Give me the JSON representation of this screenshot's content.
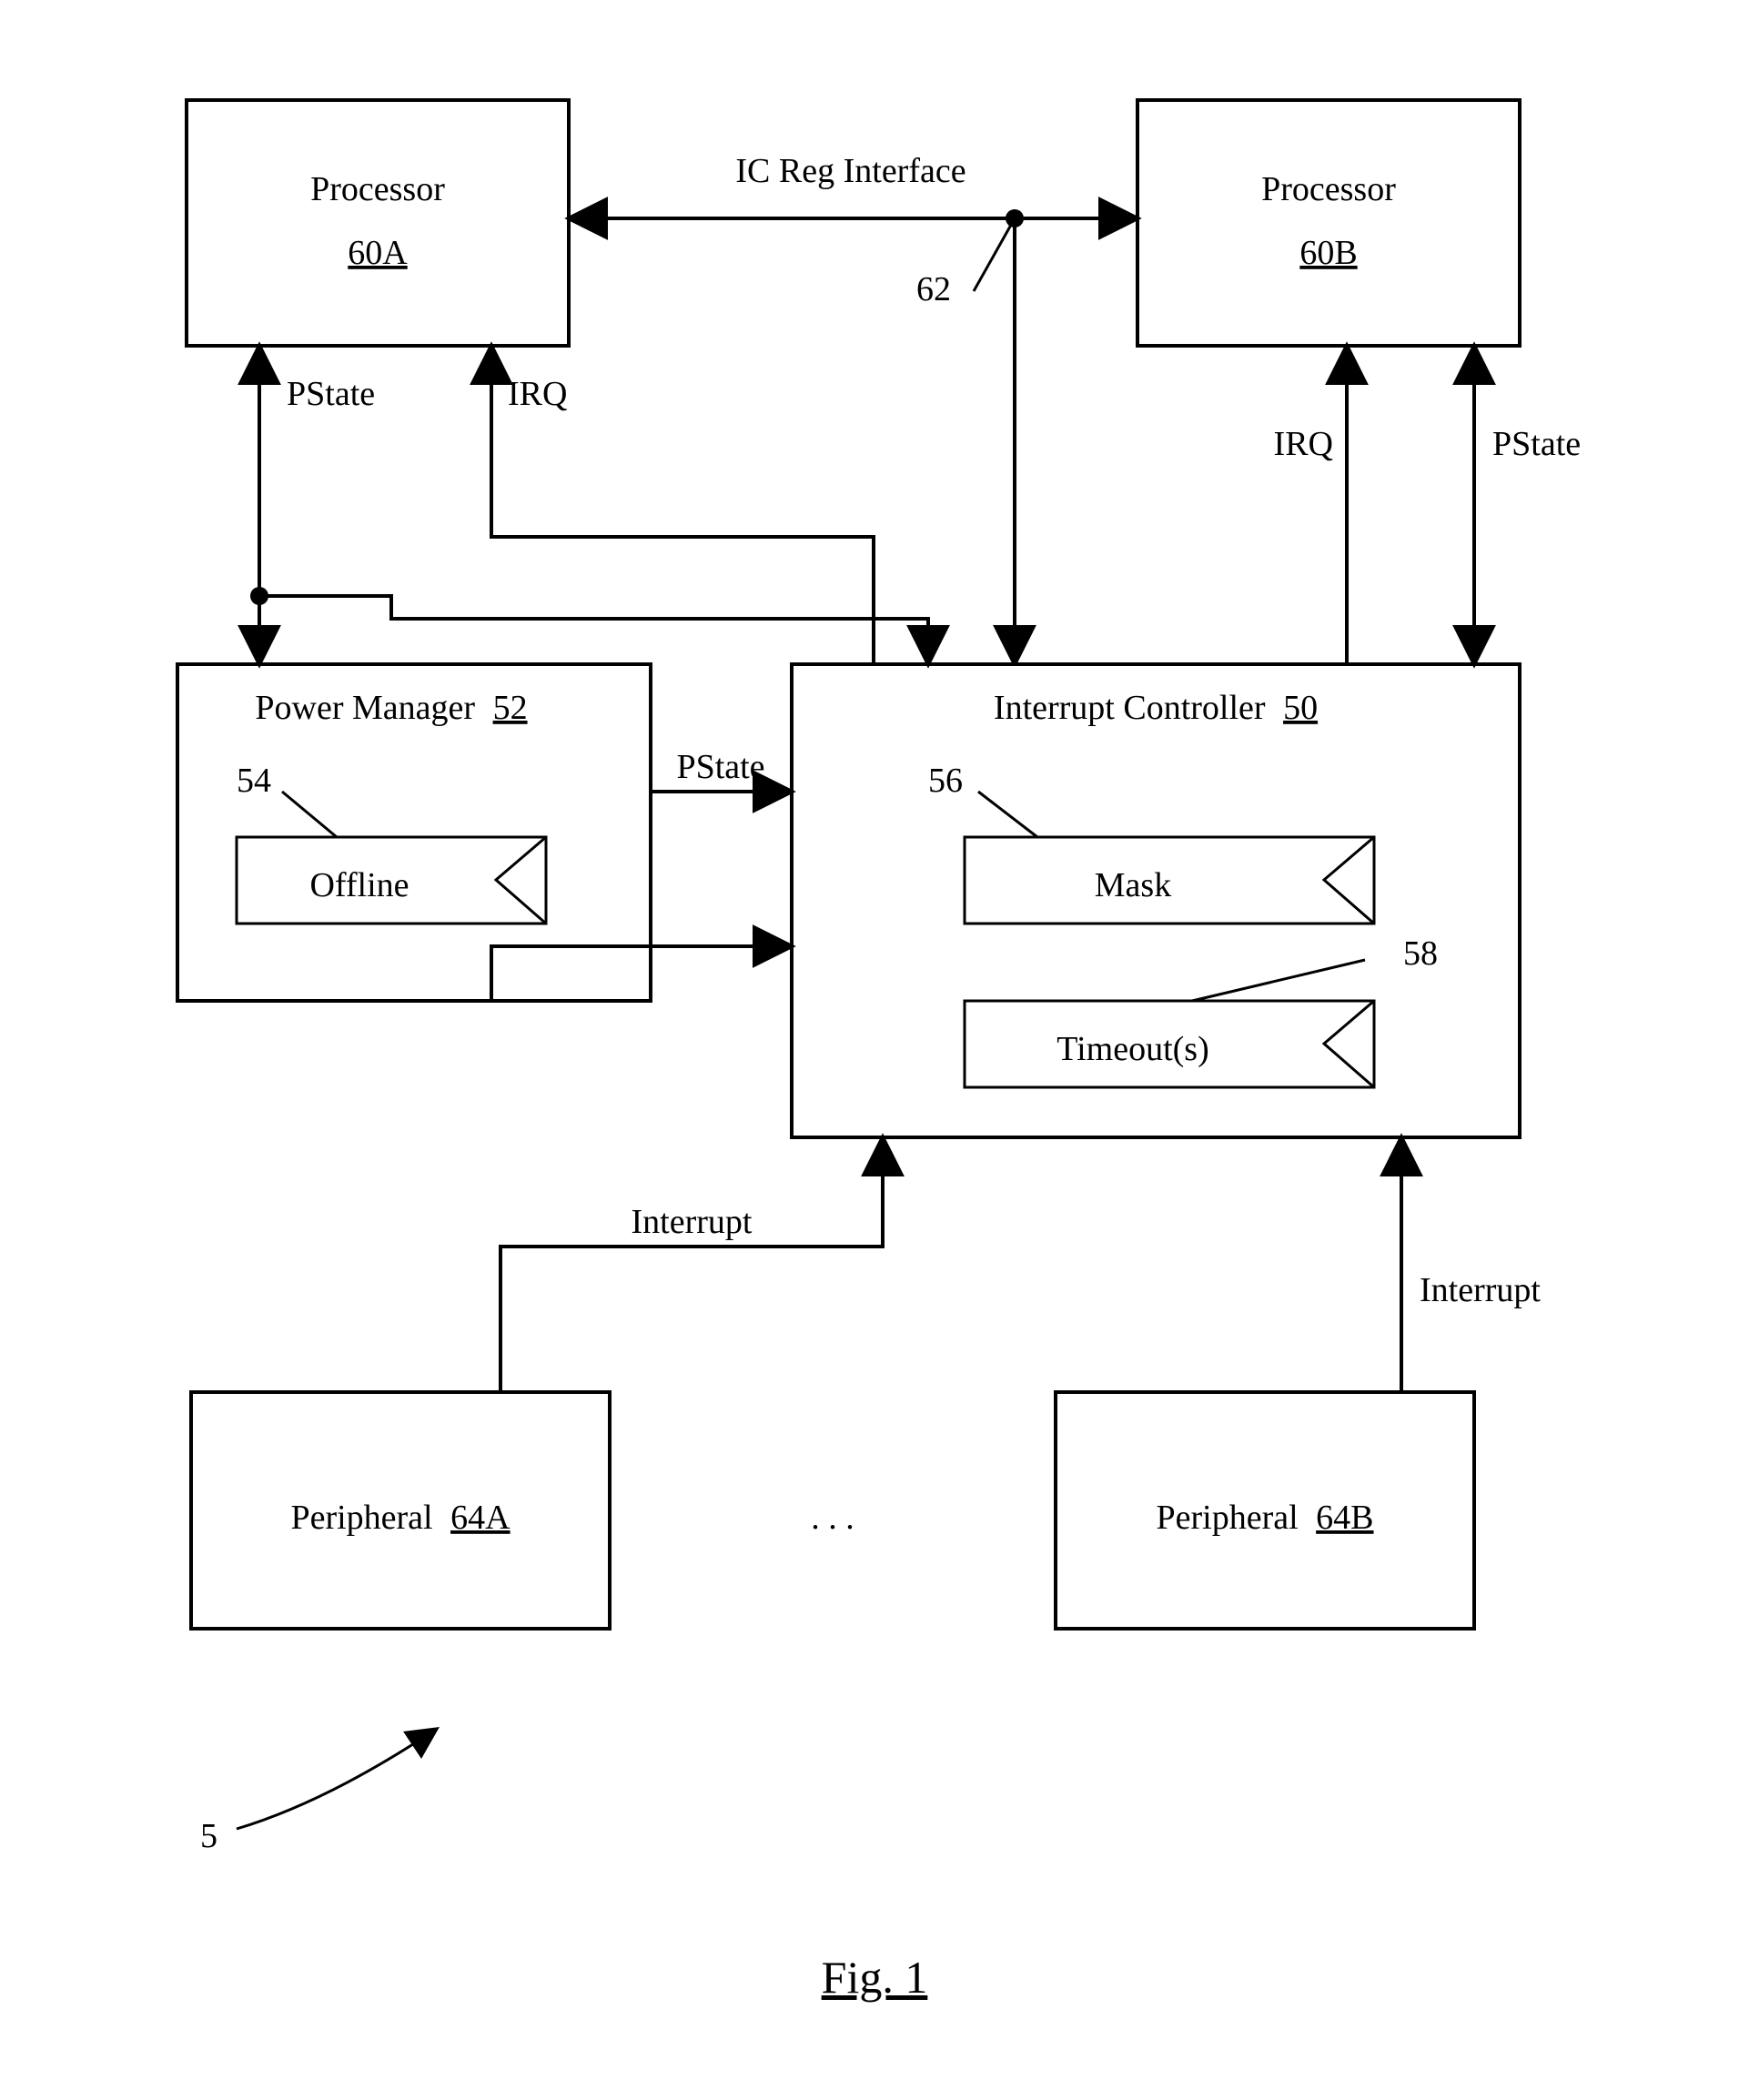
{
  "fig_label": "Fig. 1",
  "system_ref": "5",
  "bus_label": "IC Reg Interface",
  "bus_ref": "62",
  "processors": {
    "a": {
      "name": "Processor",
      "ref": "60A",
      "irq": "IRQ",
      "pstate": "PState"
    },
    "b": {
      "name": "Processor",
      "ref": "60B",
      "irq": "IRQ",
      "pstate": "PState"
    }
  },
  "power_manager": {
    "name": "Power Manager",
    "ref": "52",
    "offline": {
      "label": "Offline",
      "ref": "54"
    },
    "out_label": "PState"
  },
  "interrupt_controller": {
    "name": "Interrupt Controller",
    "ref": "50",
    "mask": {
      "label": "Mask",
      "ref": "56"
    },
    "timeout": {
      "label": "Timeout(s)",
      "ref": "58"
    }
  },
  "peripherals": {
    "a": {
      "name": "Peripheral",
      "ref": "64A",
      "signal": "Interrupt"
    },
    "b": {
      "name": "Peripheral",
      "ref": "64B",
      "signal": "Interrupt"
    },
    "ellipsis": ". . ."
  }
}
